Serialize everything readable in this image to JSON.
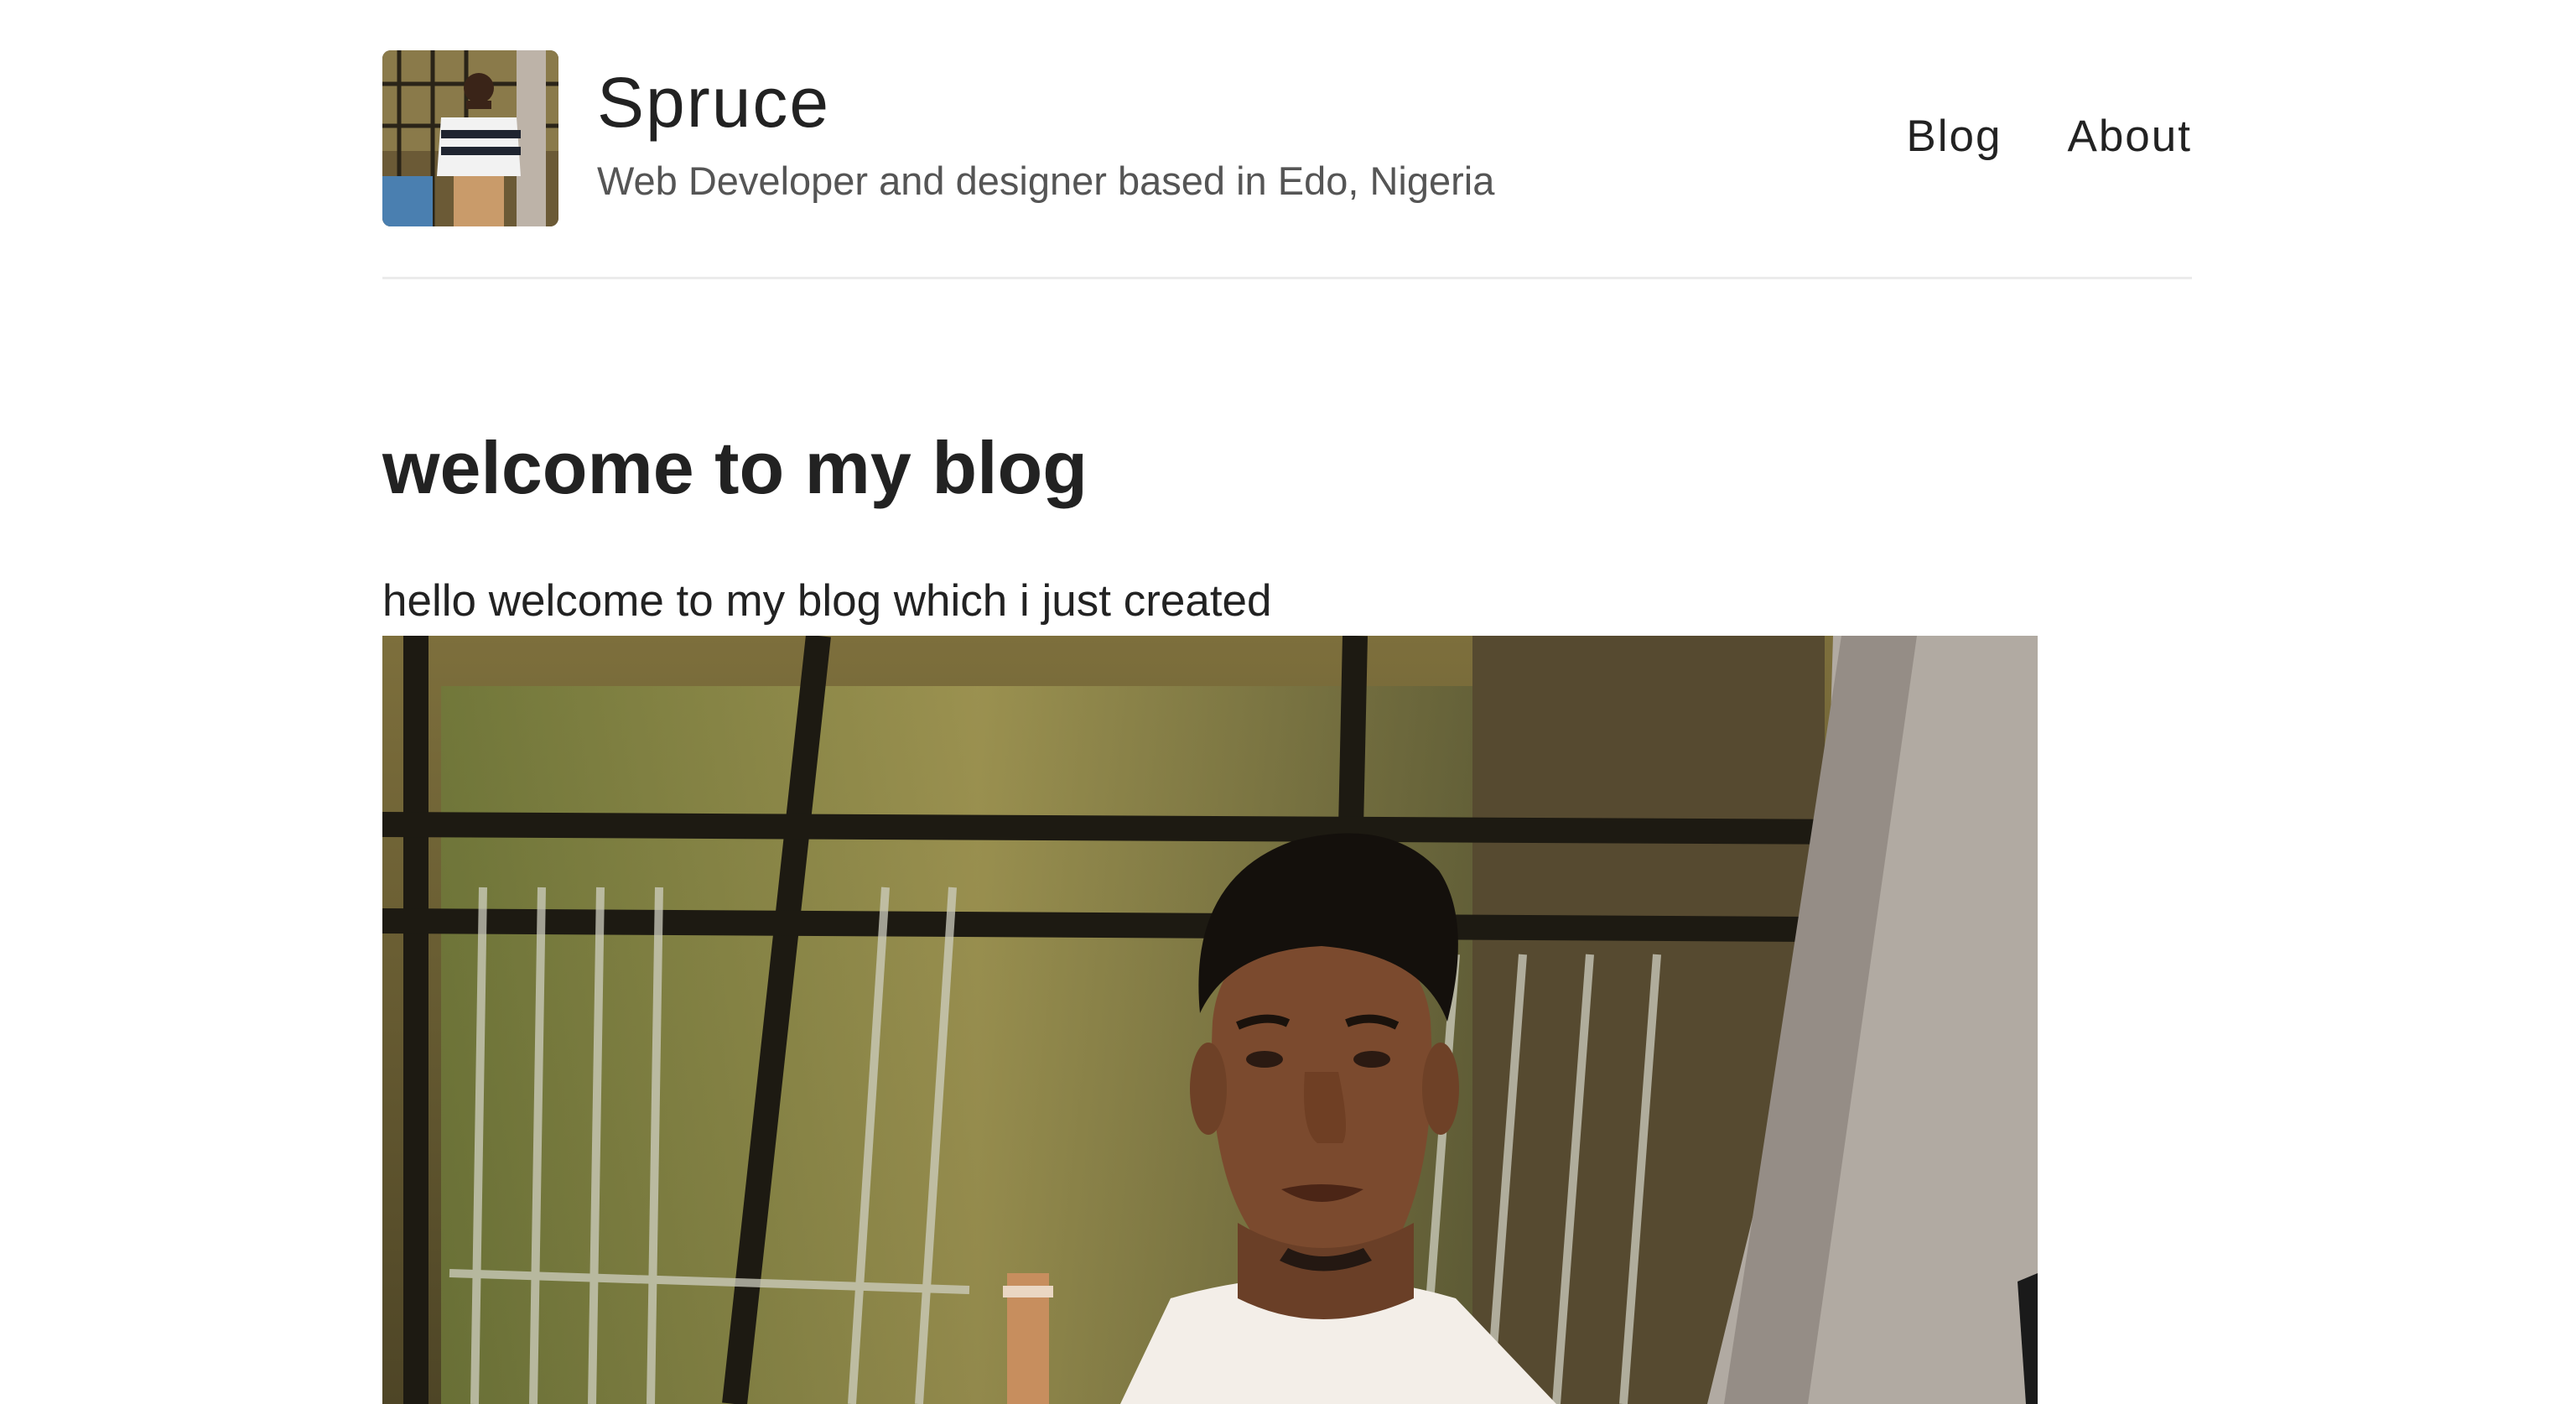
{
  "site": {
    "title": "Spruce",
    "tagline": "Web Developer and designer based in Edo, Nigeria"
  },
  "nav": {
    "items": [
      {
        "label": "Blog"
      },
      {
        "label": "About"
      }
    ]
  },
  "post": {
    "title": "welcome to my blog",
    "body": "hello welcome to my blog which i just created"
  },
  "colors": {
    "text": "#222222",
    "muted": "#555555",
    "divider": "#ebebeb",
    "background": "#ffffff"
  }
}
